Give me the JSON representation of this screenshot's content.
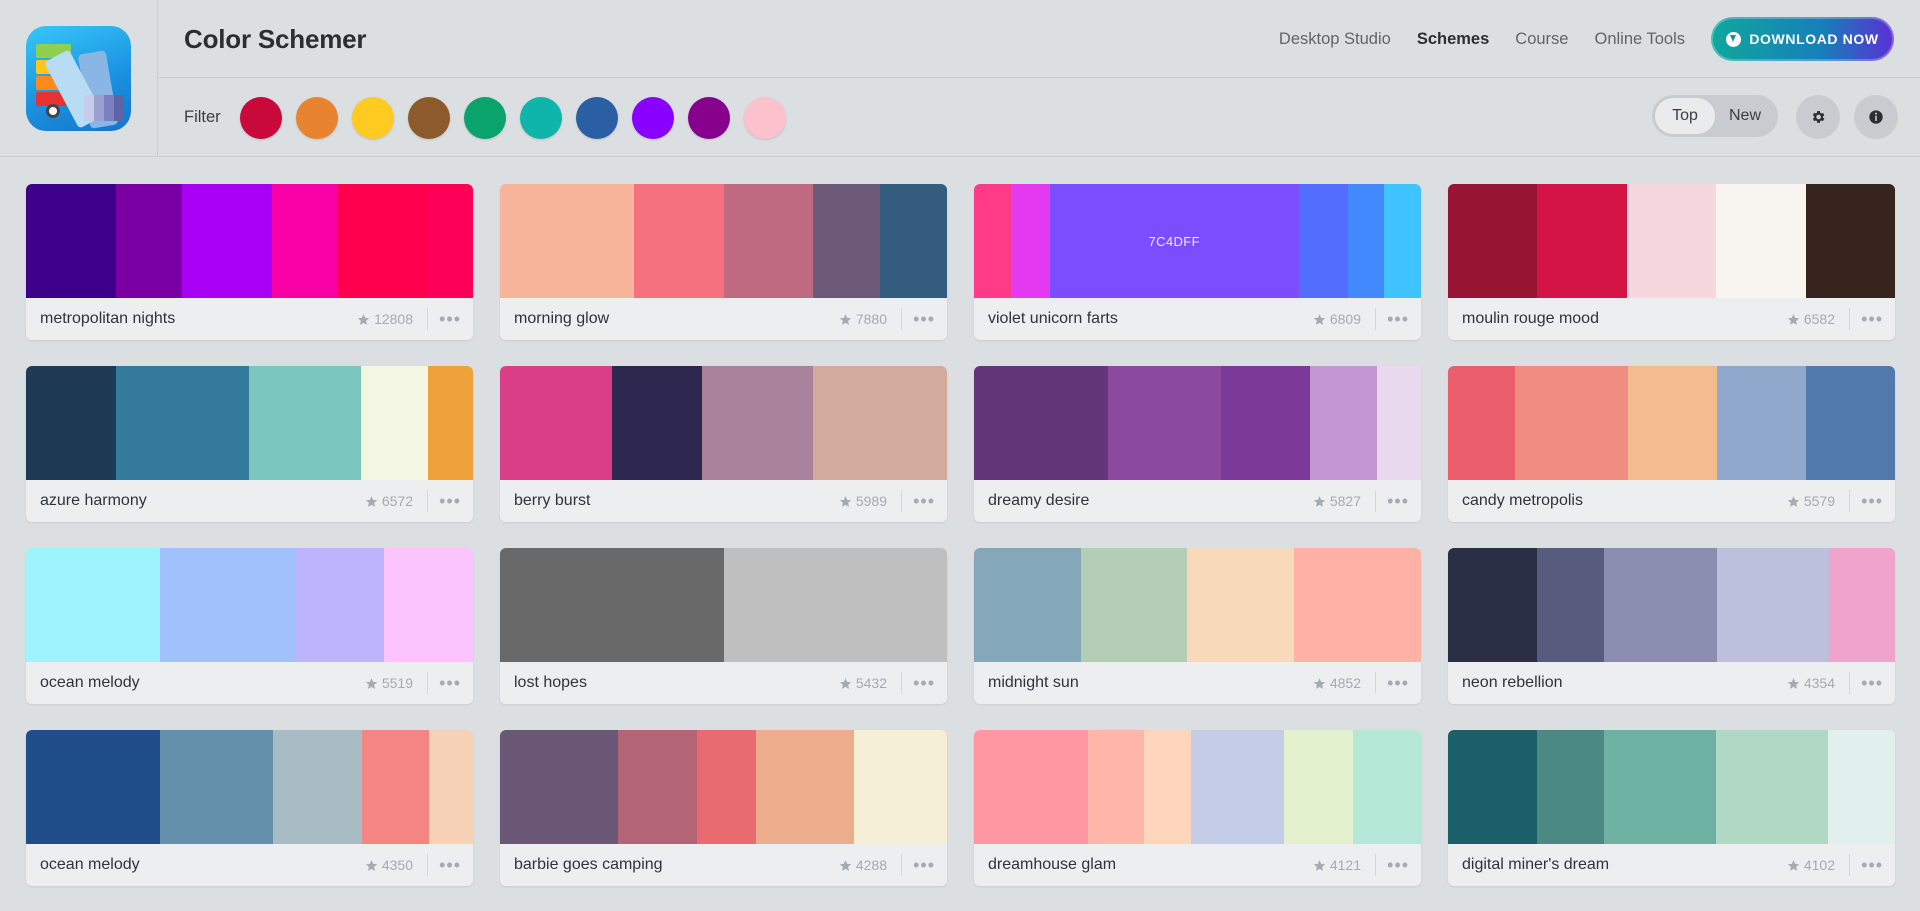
{
  "header": {
    "title": "Color Schemer",
    "nav": [
      {
        "label": "Desktop Studio",
        "active": false
      },
      {
        "label": "Schemes",
        "active": true
      },
      {
        "label": "Course",
        "active": false
      },
      {
        "label": "Online Tools",
        "active": false
      }
    ],
    "download_label": "DOWNLOAD NOW"
  },
  "filter": {
    "label": "Filter",
    "colors": [
      "#c8093a",
      "#e8832f",
      "#ffcb21",
      "#8c5a2b",
      "#0aa36d",
      "#0fb5ab",
      "#2a5fa4",
      "#8a00ff",
      "#86028c",
      "#fbc1cc"
    ],
    "sort_options": [
      "Top",
      "New"
    ],
    "sort_selected": "Top"
  },
  "icons": {
    "settings": "gear-icon",
    "info": "info-icon",
    "star": "star-icon",
    "more": "more-icon"
  },
  "schemes": [
    {
      "name": "metropolitan nights",
      "stars": "12808",
      "colors": [
        "#3d0089",
        "#7a00a4",
        "#a800f4",
        "#f800a6",
        "#ff004f",
        "#ff0058"
      ],
      "weights": [
        74,
        54,
        74,
        54,
        74,
        37
      ]
    },
    {
      "name": "morning glow",
      "stars": "7880",
      "colors": [
        "#f7b49a",
        "#f6717f",
        "#bf6a80",
        "#6c5a78",
        "#335c7f"
      ],
      "weights": [
        110,
        73,
        73,
        55,
        55
      ]
    },
    {
      "name": "violet unicorn farts",
      "stars": "6809",
      "colors": [
        "#ff3b87",
        "#e43bf2",
        "#7c4dff",
        "#536dfe",
        "#448aff",
        "#40c4ff"
      ],
      "weights": [
        30,
        32,
        203,
        40,
        30,
        30
      ],
      "labelled": "7C4DFF"
    },
    {
      "name": "moulin rouge mood",
      "stars": "6582",
      "colors": [
        "#971532",
        "#d41446",
        "#f6d7dd",
        "#f8f5f0",
        "#37241e"
      ],
      "weights": [
        73,
        73,
        73,
        73,
        73
      ]
    },
    {
      "name": "azure harmony",
      "stars": "6572",
      "colors": [
        "#1e3a55",
        "#337a9b",
        "#7cc6c0",
        "#f3f6e3",
        "#f0a23a"
      ],
      "weights": [
        74,
        109,
        92,
        55,
        37
      ]
    },
    {
      "name": "berry burst",
      "stars": "5989",
      "colors": [
        "#da3e86",
        "#2e2750",
        "#ab829c",
        "#d3ab9c"
      ],
      "weights": [
        92,
        73,
        91,
        110
      ]
    },
    {
      "name": "dreamy desire",
      "stars": "5827",
      "colors": [
        "#633579",
        "#8b4a9e",
        "#7c3a98",
        "#c497d4",
        "#e9daef"
      ],
      "weights": [
        110,
        92,
        73,
        55,
        36
      ]
    },
    {
      "name": "candy metropolis",
      "stars": "5579",
      "colors": [
        "#eb5e6b",
        "#f18c82",
        "#f2bc8e",
        "#8fa8cc",
        "#5279ac"
      ],
      "weights": [
        55,
        92,
        73,
        73,
        73
      ]
    },
    {
      "name": "ocean melody",
      "stars": "5519",
      "colors": [
        "#9ef4fd",
        "#a1c1fd",
        "#bcb4fd",
        "#fbc4fd"
      ],
      "weights": [
        110,
        110,
        73,
        73
      ]
    },
    {
      "name": "lost hopes",
      "stars": "5432",
      "colors": [
        "#696969",
        "#bfbfbf"
      ],
      "weights": [
        183,
        183
      ]
    },
    {
      "name": "midnight sun",
      "stars": "4852",
      "colors": [
        "#84a7ba",
        "#b3cdb6",
        "#f8dabb",
        "#ffb1a6"
      ],
      "weights": [
        92,
        92,
        92,
        110
      ]
    },
    {
      "name": "neon rebellion",
      "stars": "4354",
      "colors": [
        "#2b2f46",
        "#575b7d",
        "#8a8db0",
        "#bcc0dc",
        "#f0a4cc"
      ],
      "weights": [
        73,
        55,
        92,
        92,
        54
      ]
    },
    {
      "name": "ocean melody",
      "stars": "4350",
      "colors": [
        "#1f4d89",
        "#6590ab",
        "#a8bcc4",
        "#f38582",
        "#f7d2b7"
      ],
      "weights": [
        110,
        92,
        73,
        55,
        36
      ]
    },
    {
      "name": "barbie goes camping",
      "stars": "4288",
      "colors": [
        "#6b5776",
        "#b46575",
        "#e76b70",
        "#ebad8c",
        "#f4efd6"
      ],
      "weights": [
        110,
        73,
        55,
        91,
        87
      ]
    },
    {
      "name": "dreamhouse glam",
      "stars": "4121",
      "colors": [
        "#fe97a2",
        "#feb6ab",
        "#fed6bb",
        "#c4cce8",
        "#e3f1cf",
        "#b6e8d8"
      ],
      "weights": [
        110,
        55,
        45,
        90,
        67,
        66
      ]
    },
    {
      "name": "digital miner's dream",
      "stars": "4102",
      "colors": [
        "#1b5f68",
        "#4b8a82",
        "#6db1a3",
        "#b0d8c5",
        "#e1f0ec"
      ],
      "weights": [
        88,
        66,
        110,
        110,
        66
      ]
    }
  ]
}
